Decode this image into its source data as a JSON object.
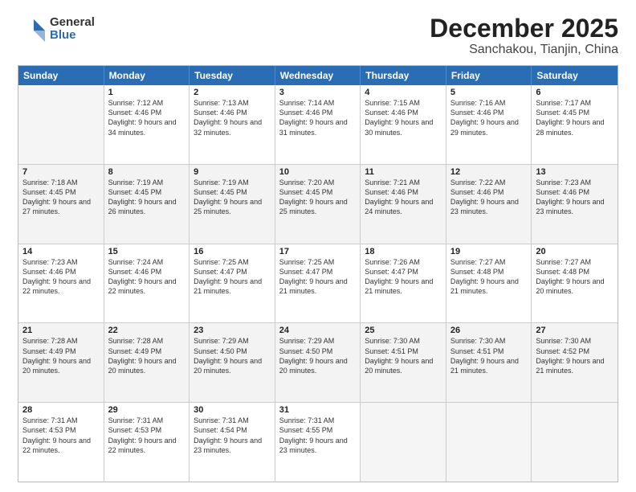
{
  "logo": {
    "general": "General",
    "blue": "Blue"
  },
  "title": {
    "month": "December 2025",
    "location": "Sanchakou, Tianjin, China"
  },
  "header_days": [
    "Sunday",
    "Monday",
    "Tuesday",
    "Wednesday",
    "Thursday",
    "Friday",
    "Saturday"
  ],
  "weeks": [
    [
      {
        "day": "",
        "empty": true
      },
      {
        "day": "1",
        "sunrise": "Sunrise: 7:12 AM",
        "sunset": "Sunset: 4:46 PM",
        "daylight": "Daylight: 9 hours and 34 minutes."
      },
      {
        "day": "2",
        "sunrise": "Sunrise: 7:13 AM",
        "sunset": "Sunset: 4:46 PM",
        "daylight": "Daylight: 9 hours and 32 minutes."
      },
      {
        "day": "3",
        "sunrise": "Sunrise: 7:14 AM",
        "sunset": "Sunset: 4:46 PM",
        "daylight": "Daylight: 9 hours and 31 minutes."
      },
      {
        "day": "4",
        "sunrise": "Sunrise: 7:15 AM",
        "sunset": "Sunset: 4:46 PM",
        "daylight": "Daylight: 9 hours and 30 minutes."
      },
      {
        "day": "5",
        "sunrise": "Sunrise: 7:16 AM",
        "sunset": "Sunset: 4:46 PM",
        "daylight": "Daylight: 9 hours and 29 minutes."
      },
      {
        "day": "6",
        "sunrise": "Sunrise: 7:17 AM",
        "sunset": "Sunset: 4:45 PM",
        "daylight": "Daylight: 9 hours and 28 minutes."
      }
    ],
    [
      {
        "day": "7",
        "sunrise": "Sunrise: 7:18 AM",
        "sunset": "Sunset: 4:45 PM",
        "daylight": "Daylight: 9 hours and 27 minutes."
      },
      {
        "day": "8",
        "sunrise": "Sunrise: 7:19 AM",
        "sunset": "Sunset: 4:45 PM",
        "daylight": "Daylight: 9 hours and 26 minutes."
      },
      {
        "day": "9",
        "sunrise": "Sunrise: 7:19 AM",
        "sunset": "Sunset: 4:45 PM",
        "daylight": "Daylight: 9 hours and 25 minutes."
      },
      {
        "day": "10",
        "sunrise": "Sunrise: 7:20 AM",
        "sunset": "Sunset: 4:45 PM",
        "daylight": "Daylight: 9 hours and 25 minutes."
      },
      {
        "day": "11",
        "sunrise": "Sunrise: 7:21 AM",
        "sunset": "Sunset: 4:46 PM",
        "daylight": "Daylight: 9 hours and 24 minutes."
      },
      {
        "day": "12",
        "sunrise": "Sunrise: 7:22 AM",
        "sunset": "Sunset: 4:46 PM",
        "daylight": "Daylight: 9 hours and 23 minutes."
      },
      {
        "day": "13",
        "sunrise": "Sunrise: 7:23 AM",
        "sunset": "Sunset: 4:46 PM",
        "daylight": "Daylight: 9 hours and 23 minutes."
      }
    ],
    [
      {
        "day": "14",
        "sunrise": "Sunrise: 7:23 AM",
        "sunset": "Sunset: 4:46 PM",
        "daylight": "Daylight: 9 hours and 22 minutes."
      },
      {
        "day": "15",
        "sunrise": "Sunrise: 7:24 AM",
        "sunset": "Sunset: 4:46 PM",
        "daylight": "Daylight: 9 hours and 22 minutes."
      },
      {
        "day": "16",
        "sunrise": "Sunrise: 7:25 AM",
        "sunset": "Sunset: 4:47 PM",
        "daylight": "Daylight: 9 hours and 21 minutes."
      },
      {
        "day": "17",
        "sunrise": "Sunrise: 7:25 AM",
        "sunset": "Sunset: 4:47 PM",
        "daylight": "Daylight: 9 hours and 21 minutes."
      },
      {
        "day": "18",
        "sunrise": "Sunrise: 7:26 AM",
        "sunset": "Sunset: 4:47 PM",
        "daylight": "Daylight: 9 hours and 21 minutes."
      },
      {
        "day": "19",
        "sunrise": "Sunrise: 7:27 AM",
        "sunset": "Sunset: 4:48 PM",
        "daylight": "Daylight: 9 hours and 21 minutes."
      },
      {
        "day": "20",
        "sunrise": "Sunrise: 7:27 AM",
        "sunset": "Sunset: 4:48 PM",
        "daylight": "Daylight: 9 hours and 20 minutes."
      }
    ],
    [
      {
        "day": "21",
        "sunrise": "Sunrise: 7:28 AM",
        "sunset": "Sunset: 4:49 PM",
        "daylight": "Daylight: 9 hours and 20 minutes."
      },
      {
        "day": "22",
        "sunrise": "Sunrise: 7:28 AM",
        "sunset": "Sunset: 4:49 PM",
        "daylight": "Daylight: 9 hours and 20 minutes."
      },
      {
        "day": "23",
        "sunrise": "Sunrise: 7:29 AM",
        "sunset": "Sunset: 4:50 PM",
        "daylight": "Daylight: 9 hours and 20 minutes."
      },
      {
        "day": "24",
        "sunrise": "Sunrise: 7:29 AM",
        "sunset": "Sunset: 4:50 PM",
        "daylight": "Daylight: 9 hours and 20 minutes."
      },
      {
        "day": "25",
        "sunrise": "Sunrise: 7:30 AM",
        "sunset": "Sunset: 4:51 PM",
        "daylight": "Daylight: 9 hours and 20 minutes."
      },
      {
        "day": "26",
        "sunrise": "Sunrise: 7:30 AM",
        "sunset": "Sunset: 4:51 PM",
        "daylight": "Daylight: 9 hours and 21 minutes."
      },
      {
        "day": "27",
        "sunrise": "Sunrise: 7:30 AM",
        "sunset": "Sunset: 4:52 PM",
        "daylight": "Daylight: 9 hours and 21 minutes."
      }
    ],
    [
      {
        "day": "28",
        "sunrise": "Sunrise: 7:31 AM",
        "sunset": "Sunset: 4:53 PM",
        "daylight": "Daylight: 9 hours and 22 minutes."
      },
      {
        "day": "29",
        "sunrise": "Sunrise: 7:31 AM",
        "sunset": "Sunset: 4:53 PM",
        "daylight": "Daylight: 9 hours and 22 minutes."
      },
      {
        "day": "30",
        "sunrise": "Sunrise: 7:31 AM",
        "sunset": "Sunset: 4:54 PM",
        "daylight": "Daylight: 9 hours and 23 minutes."
      },
      {
        "day": "31",
        "sunrise": "Sunrise: 7:31 AM",
        "sunset": "Sunset: 4:55 PM",
        "daylight": "Daylight: 9 hours and 23 minutes."
      },
      {
        "day": "",
        "empty": true
      },
      {
        "day": "",
        "empty": true
      },
      {
        "day": "",
        "empty": true
      }
    ]
  ]
}
